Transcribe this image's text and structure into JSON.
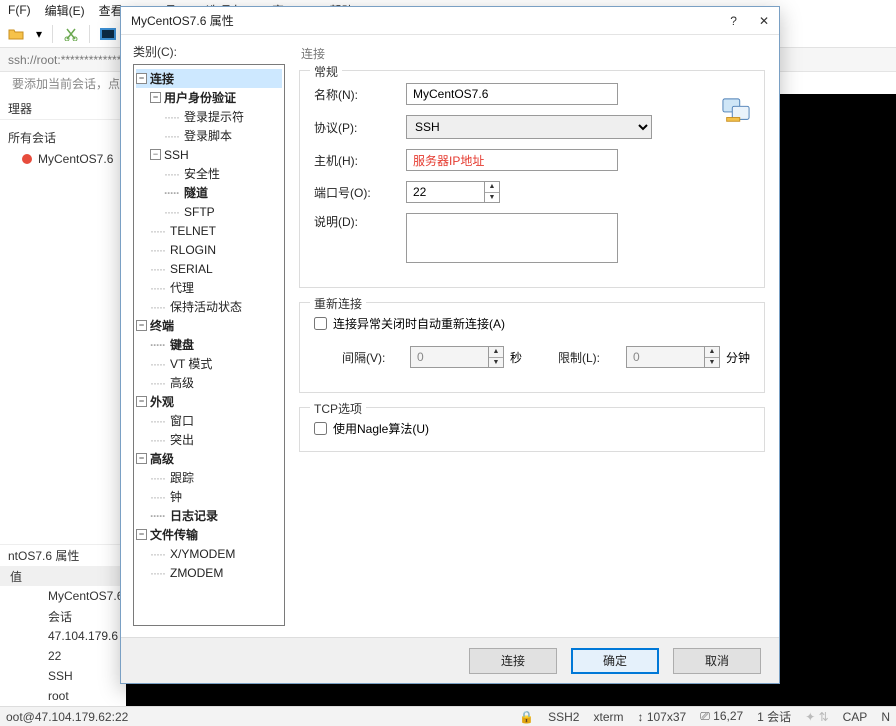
{
  "menu": {
    "file": "F(F)",
    "edit": "编辑(E)",
    "view": "查看(V)",
    "tools": "工具(T)",
    "tabs": "选项卡(B)",
    "window": "窗口(W)",
    "help": "帮助(H)"
  },
  "addressbar": "ssh://root:****************",
  "add_session_msg": "要添加当前会话，点击",
  "left": {
    "manager": "理器",
    "all_sessions": "所有会话",
    "session_name": "MyCentOS7.6"
  },
  "props": {
    "title": "ntOS7.6 属性",
    "col_value": "值",
    "r1": "MyCentOS7.6",
    "r2": "会话",
    "r3": "47.104.179.6",
    "r4": "22",
    "r5": "SSH",
    "r6": "root"
  },
  "dialog": {
    "title": "MyCentOS7.6 属性",
    "help": "?",
    "close": "✕",
    "category_label": "类别(C):",
    "tree": {
      "connect": "连接",
      "auth": "用户身份验证",
      "login_prompt": "登录提示符",
      "login_script": "登录脚本",
      "ssh": "SSH",
      "security": "安全性",
      "tunnel": "隧道",
      "sftp": "SFTP",
      "telnet": "TELNET",
      "rlogin": "RLOGIN",
      "serial": "SERIAL",
      "proxy": "代理",
      "keepalive": "保持活动状态",
      "terminal": "终端",
      "keyboard": "键盘",
      "vt": "VT 模式",
      "adv1": "高级",
      "appearance": "外观",
      "window": "窗口",
      "highlight": "突出",
      "advanced": "高级",
      "trace": "跟踪",
      "bell": "钟",
      "log": "日志记录",
      "file": "文件传输",
      "xy": "X/YMODEM",
      "z": "ZMODEM"
    },
    "section_connect": "连接",
    "general": {
      "legend": "常规",
      "name_lab": "名称(N):",
      "name_val": "MyCentOS7.6",
      "proto_lab": "协议(P):",
      "proto_val": "SSH",
      "host_lab": "主机(H):",
      "host_val": "服务器IP地址",
      "port_lab": "端口号(O):",
      "port_val": "22",
      "desc_lab": "说明(D):",
      "desc_val": ""
    },
    "reconnect": {
      "legend": "重新连接",
      "chk": "连接异常关闭时自动重新连接(A)",
      "interval_lab": "间隔(V):",
      "interval_val": "0",
      "sec": "秒",
      "limit_lab": "限制(L):",
      "limit_val": "0",
      "min": "分钟"
    },
    "tcp": {
      "legend": "TCP选项",
      "nagle": "使用Nagle算法(U)"
    },
    "buttons": {
      "connect": "连接",
      "ok": "确定",
      "cancel": "取消"
    }
  },
  "status": {
    "left": "oot@47.104.179.62:22",
    "ssh": "SSH2",
    "term": "xterm",
    "size": "107x37",
    "pos": "16,27",
    "sess": "1 会话",
    "cap": "CAP",
    "n": "N"
  }
}
